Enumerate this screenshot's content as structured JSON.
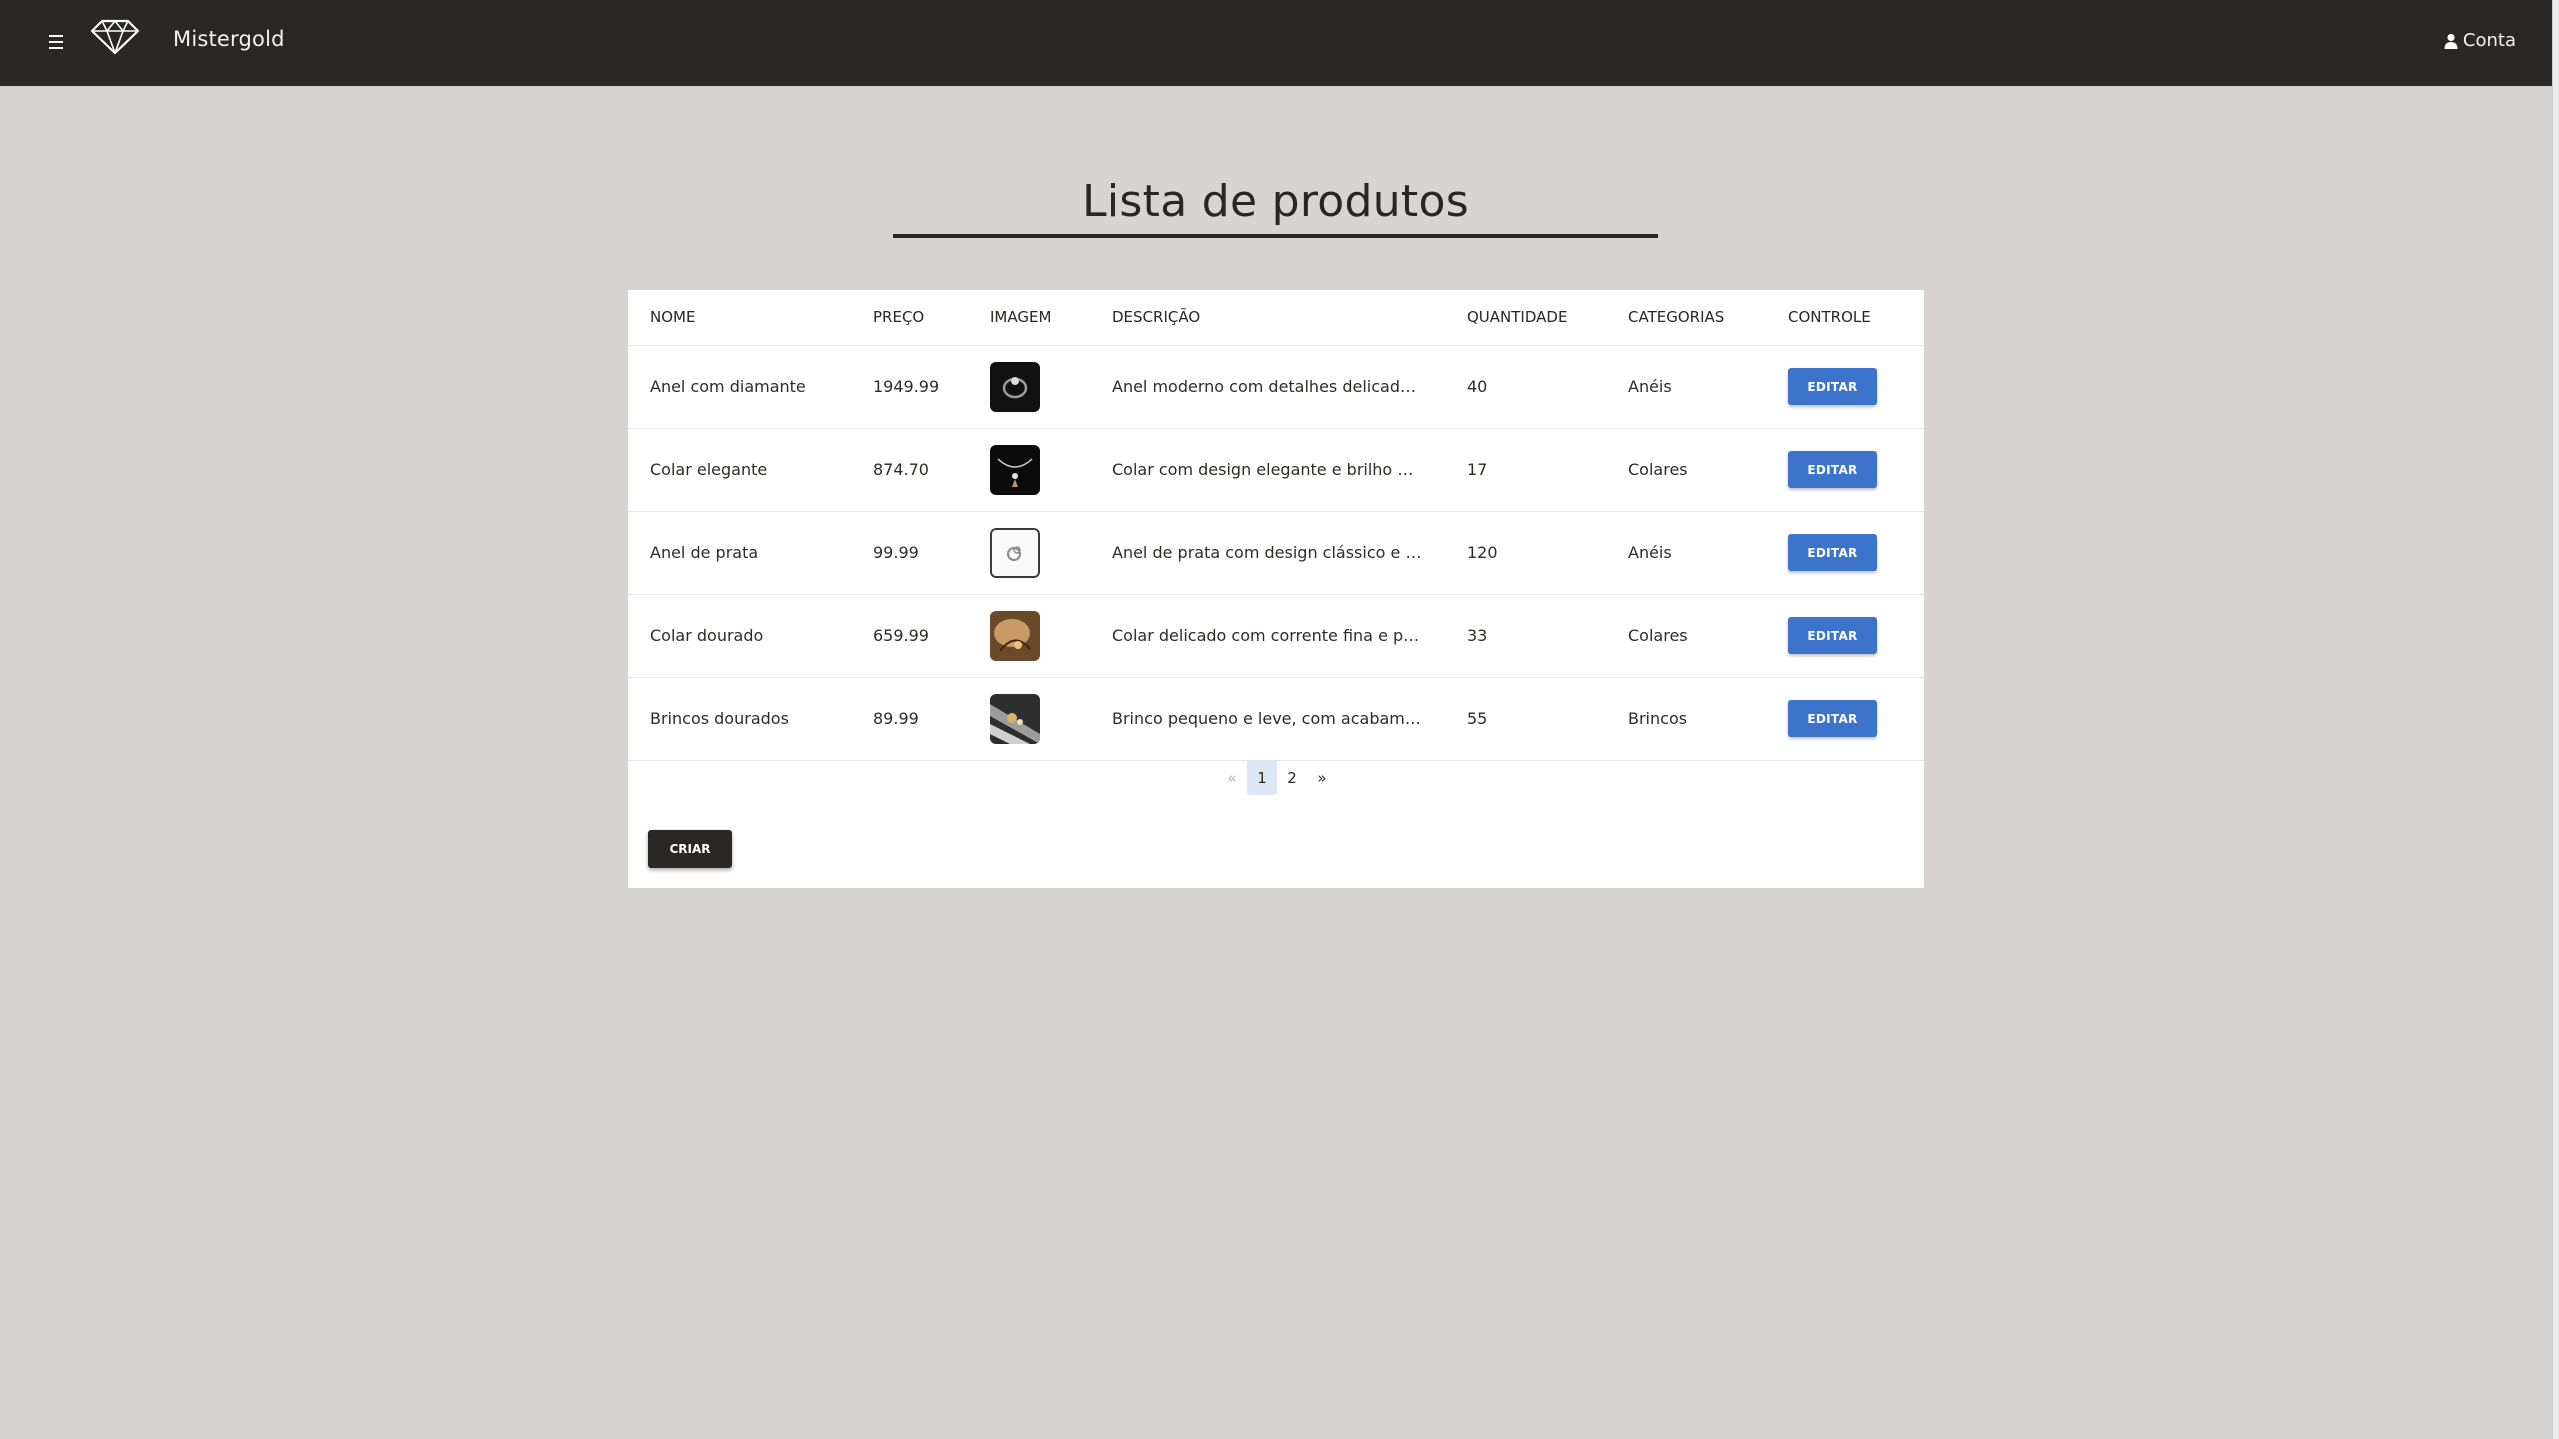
{
  "app": {
    "brand": "Mistergold",
    "account_label": "Conta"
  },
  "page": {
    "title": "Lista de produtos"
  },
  "table": {
    "headers": {
      "nome": "NOME",
      "preco": "PREÇO",
      "imagem": "IMAGEM",
      "descricao": "DESCRIÇÃO",
      "quantidade": "QUANTIDADE",
      "categorias": "CATEGORIAS",
      "controle": "CONTROLE"
    },
    "rows": [
      {
        "nome": "Anel com diamante",
        "preco": "1949.99",
        "descricao": "Anel moderno com detalhes delicados, p...",
        "quantidade": "40",
        "categoria": "Anéis",
        "acao": "EDITAR"
      },
      {
        "nome": "Colar elegante",
        "preco": "874.70",
        "descricao": "Colar com design elegante e brilho marc...",
        "quantidade": "17",
        "categoria": "Colares",
        "acao": "EDITAR"
      },
      {
        "nome": "Anel de prata",
        "preco": "99.99",
        "descricao": "Anel de prata com design clássico e aca...",
        "quantidade": "120",
        "categoria": "Anéis",
        "acao": "EDITAR"
      },
      {
        "nome": "Colar dourado",
        "preco": "659.99",
        "descricao": "Colar delicado com corrente fina e pinge...",
        "quantidade": "33",
        "categoria": "Colares",
        "acao": "EDITAR"
      },
      {
        "nome": "Brincos dourados",
        "preco": "89.99",
        "descricao": "Brinco pequeno e leve, com acabamento...",
        "quantidade": "55",
        "categoria": "Brincos",
        "acao": "EDITAR"
      }
    ]
  },
  "pagination": {
    "prev": "«",
    "pages": [
      "1",
      "2"
    ],
    "current": "1",
    "next": "»"
  },
  "actions": {
    "create_label": "CRIAR"
  },
  "colors": {
    "topbar": "#2b2725",
    "background": "#d8d4d1",
    "edit_button": "#3c74cc",
    "create_button": "#2b2725"
  }
}
